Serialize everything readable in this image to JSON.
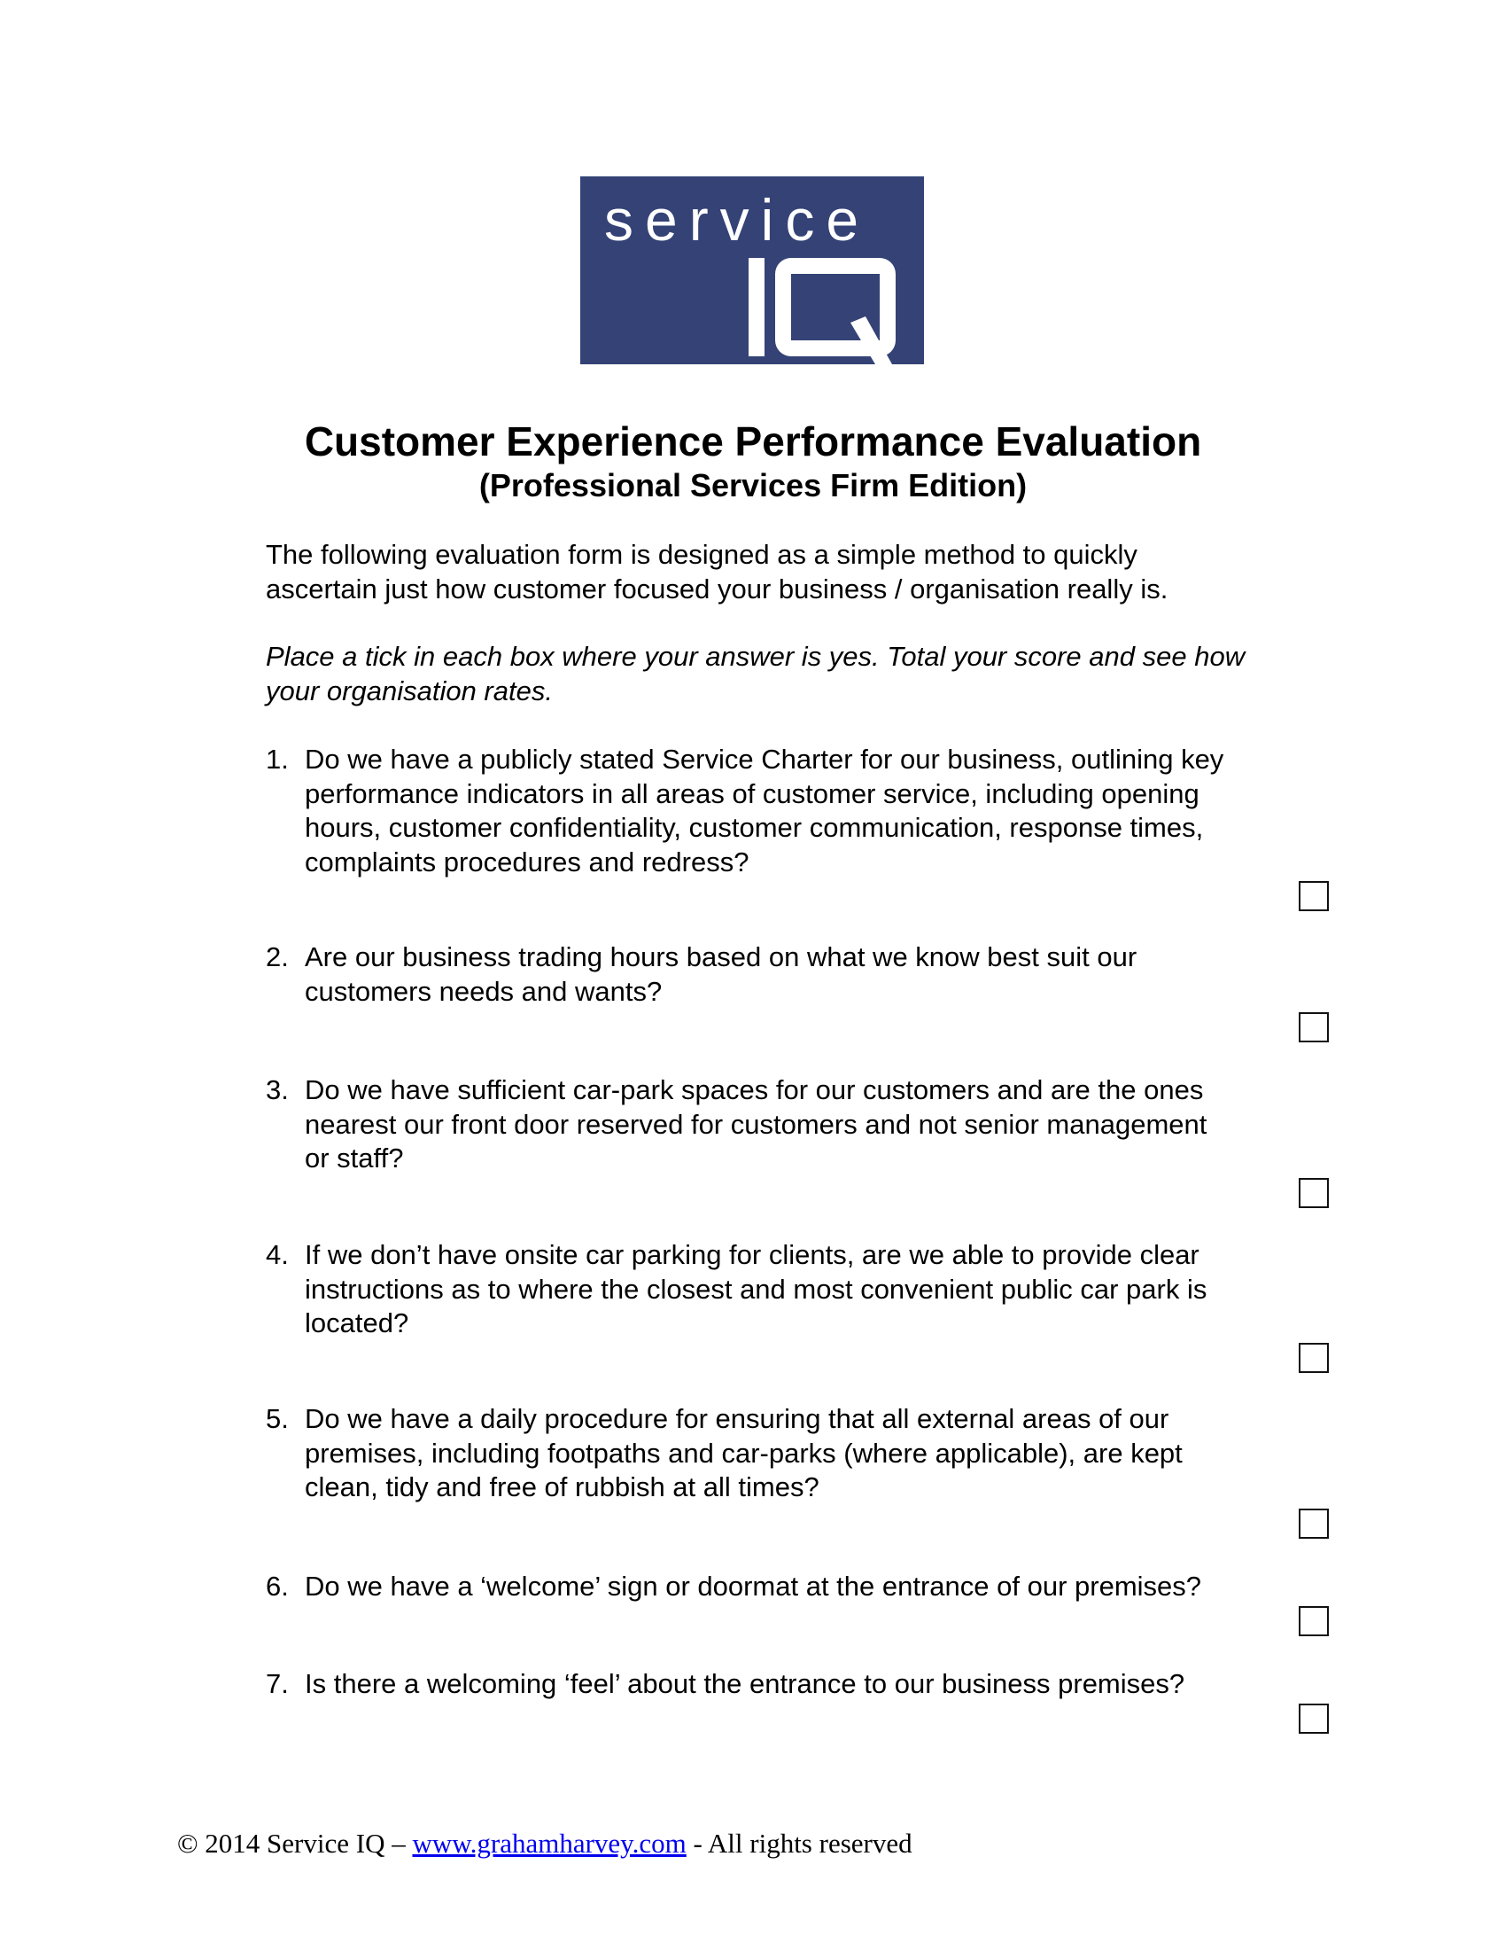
{
  "logo": {
    "line1": "service",
    "line2": "IQ",
    "background_color": "#344276",
    "text_color": "#ffffff"
  },
  "header": {
    "title": "Customer Experience Performance Evaluation",
    "subtitle": "(Professional Services Firm Edition)"
  },
  "intro": {
    "line1": "The following evaluation form is designed as a simple method to quickly",
    "line2": "ascertain just how customer focused your business / organisation really is."
  },
  "instruction": {
    "line1": "Place a tick in each box where your answer is yes. Total your score and see how",
    "line2": "your organisation rates."
  },
  "questions": [
    {
      "number": "1.",
      "lines": [
        "Do we have a publicly stated Service Charter for our business, outlining key",
        "performance indicators in all areas of customer service, including opening",
        "hours, customer confidentiality, customer communication, response times,",
        "complaints procedures and redress?"
      ],
      "checked": false
    },
    {
      "number": "2.",
      "lines": [
        "Are our business trading hours based on what we know best suit our",
        "customers needs and wants?"
      ],
      "checked": false
    },
    {
      "number": "3.",
      "lines": [
        "Do we have sufficient car-park spaces for our customers and are the ones",
        "nearest our front door reserved for customers and not senior management",
        "or staff?"
      ],
      "checked": false
    },
    {
      "number": "4.",
      "lines": [
        "If we don’t have onsite car parking for clients, are we able to provide clear",
        "instructions as to where the closest and most convenient public car park is",
        "located?"
      ],
      "checked": false
    },
    {
      "number": "5.",
      "lines": [
        "Do we have a daily procedure for ensuring that all external areas of our",
        "premises, including footpaths and car-parks (where applicable), are kept",
        "clean, tidy and free of rubbish at all times?"
      ],
      "checked": false
    },
    {
      "number": "6.",
      "lines": [
        "Do we have a ‘welcome’ sign or doormat at the entrance of our premises?"
      ],
      "checked": false
    },
    {
      "number": "7.",
      "lines": [
        "Is there a welcoming ‘feel’ about the entrance to our business premises?"
      ],
      "checked": false
    }
  ],
  "footer": {
    "prefix": "© 2014 Service IQ – ",
    "link_text": "www.grahamharvey.com",
    "suffix": " - All rights reserved",
    "link_color": "#0000ee"
  }
}
